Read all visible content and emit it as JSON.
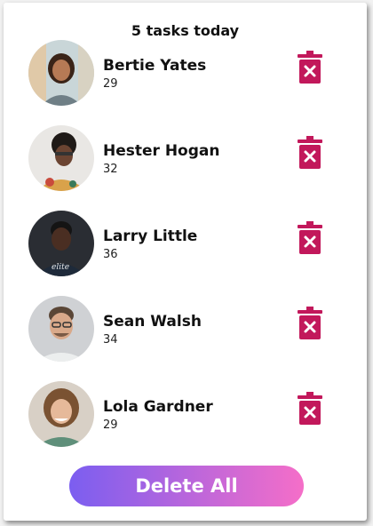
{
  "header": {
    "title": "5 tasks today"
  },
  "people": [
    {
      "name": "Bertie Yates",
      "age": "29",
      "avatar": "avatar-photo"
    },
    {
      "name": "Hester Hogan",
      "age": "32",
      "avatar": "avatar-photo"
    },
    {
      "name": "Larry Little",
      "age": "36",
      "avatar": "avatar-photo"
    },
    {
      "name": "Sean Walsh",
      "age": "34",
      "avatar": "avatar-photo"
    },
    {
      "name": "Lola Gardner",
      "age": "29",
      "avatar": "avatar-photo"
    }
  ],
  "actions": {
    "delete_all_label": "Delete All"
  },
  "colors": {
    "trash": "#c2185b",
    "button_gradient_start": "#7b5ef0",
    "button_gradient_end": "#f56ec8"
  },
  "icons": {
    "trash": "trash-x-icon"
  }
}
